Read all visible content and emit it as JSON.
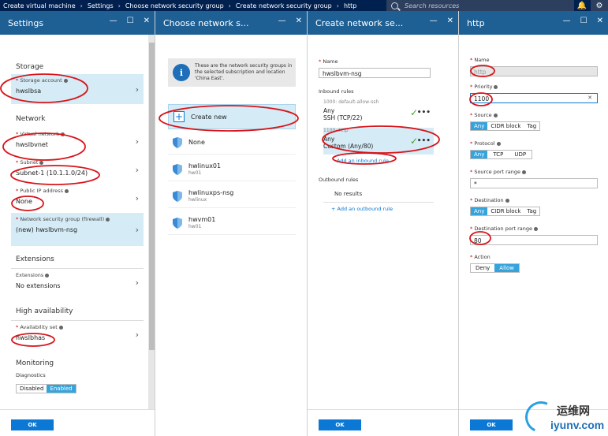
{
  "topbar": {
    "crumbs": [
      "Create virtual machine",
      "Settings",
      "Choose network security group",
      "Create network security group",
      "http"
    ],
    "search_placeholder": "Search resources",
    "colors": {
      "bar": "#002050",
      "accent": "#0a78d4"
    }
  },
  "settings": {
    "title": "Settings",
    "storage_header": "Storage",
    "storage_account_label": "Storage account",
    "storage_account_value": "hwslbsa",
    "network_header": "Network",
    "vnet_label": "Virtual network",
    "vnet_value": "hwslbvnet",
    "subnet_label": "Subnet",
    "subnet_value": "Subnet-1 (10.1.1.0/24)",
    "pip_label": "Public IP address",
    "pip_value": "None",
    "nsg_label": "Network security group (firewall)",
    "nsg_value": "(new) hwslbvm-nsg",
    "extensions_header": "Extensions",
    "extensions_label": "Extensions",
    "extensions_value": "No extensions",
    "ha_header": "High availability",
    "avset_label": "Availability set",
    "avset_value": "hwslbhas",
    "monitoring_header": "Monitoring",
    "diagnostics_label": "Diagnostics",
    "diag_disabled": "Disabled",
    "diag_enabled": "Enabled",
    "ok": "OK"
  },
  "choose_nsg": {
    "title": "Choose network s...",
    "info_text": "These are the network security groups in the selected subscription and location 'China East'.",
    "create_new": "Create new",
    "items": [
      {
        "name": "None",
        "sub": ""
      },
      {
        "name": "hwlinux01",
        "sub": "hw01"
      },
      {
        "name": "hwlinuxps-nsg",
        "sub": "hwlinux"
      },
      {
        "name": "hwvm01",
        "sub": "hw01"
      }
    ]
  },
  "create_nsg": {
    "title": "Create network se...",
    "name_label": "Name",
    "name_value": "hwslbvm-nsg",
    "inbound_label": "Inbound rules",
    "rule1_title": "1000: default-allow-ssh",
    "rule1_line1": "Any",
    "rule1_line2": "SSH (TCP/22)",
    "rule2_title": "1100: http",
    "rule2_line1": "Any",
    "rule2_line2": "Custom (Any/80)",
    "add_inbound": "Add an inbound rule",
    "outbound_label": "Outbound rules",
    "no_results": "No results",
    "add_outbound": "+ Add an outbound rule",
    "ok": "OK"
  },
  "http": {
    "title": "http",
    "name_label": "Name",
    "name_value": "http",
    "priority_label": "Priority",
    "priority_value": "1100",
    "source_label": "Source",
    "source_opts": [
      "Any",
      "CIDR block",
      "Tag"
    ],
    "protocol_label": "Protocol",
    "protocol_opts": [
      "Any",
      "TCP",
      "UDP"
    ],
    "src_port_label": "Source port range",
    "src_port_value": "*",
    "dest_label": "Destination",
    "dest_opts": [
      "Any",
      "CIDR block",
      "Tag"
    ],
    "dest_port_label": "Destination port range",
    "dest_port_value": "80",
    "action_label": "Action",
    "action_opts": [
      "Deny",
      "Allow"
    ],
    "ok": "OK"
  },
  "watermark": {
    "cn": "运维网",
    "en": "iyunv.com"
  }
}
